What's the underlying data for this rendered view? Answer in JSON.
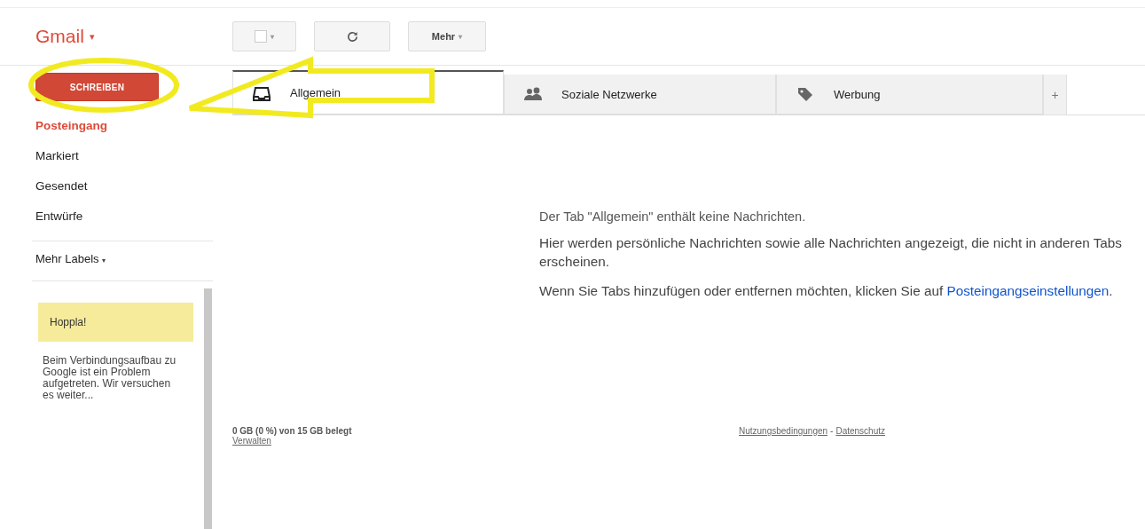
{
  "app": {
    "logo": "Gmail",
    "logo_caret": "▾"
  },
  "toolbar": {
    "select_caret": "▾",
    "more": "Mehr",
    "more_caret": "▾"
  },
  "compose": "SCHREIBEN",
  "nav": [
    {
      "label": "Posteingang",
      "selected": true
    },
    {
      "label": "Markiert",
      "selected": false
    },
    {
      "label": "Gesendet",
      "selected": false
    },
    {
      "label": "Entwürfe",
      "selected": false
    }
  ],
  "more_labels": {
    "label": "Mehr Labels",
    "caret": "▾"
  },
  "chat_notice": {
    "title": "Hoppla!",
    "text": "Beim Verbindungsaufbau zu Google ist ein Problem aufgetreten. Wir versuchen es weiter..."
  },
  "tabs": [
    {
      "label": "Allgemein",
      "kind": "inbox",
      "selected": true
    },
    {
      "label": "Soziale Netzwerke",
      "kind": "people",
      "selected": false
    },
    {
      "label": "Werbung",
      "kind": "tag",
      "selected": false
    }
  ],
  "add_tab": "+",
  "empty_state": {
    "heading": "Der Tab \"Allgemein\" enthält keine Nachrichten.",
    "text": "Hier werden persönliche Nachrichten sowie alle Nachrichten angezeigt, die nicht in anderen Tabs erscheinen.",
    "hint": "Wenn Sie Tabs hinzufügen oder entfernen möchten, klicken Sie auf",
    "link": "Posteingangseinstellungen",
    "hint_end": "."
  },
  "footer": {
    "storage": "0 GB (0 %) von 15 GB belegt",
    "manage": "Verwalten",
    "terms": "Nutzungsbedingungen",
    "separator": "-",
    "privacy": "Datenschutz"
  }
}
